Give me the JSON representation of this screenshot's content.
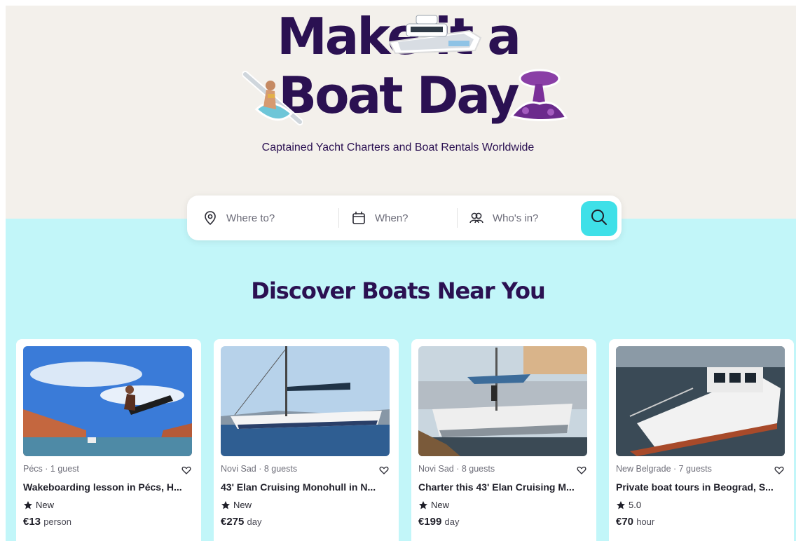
{
  "hero": {
    "headline_line1": "Make    it a",
    "headline_line2": "Boat Day",
    "subtitle": "Captained Yacht Charters and Boat Rentals Worldwide"
  },
  "search": {
    "where_placeholder": "Where to?",
    "when_placeholder": "When?",
    "who_placeholder": "Who's in?",
    "icons": [
      "location-pin-icon",
      "calendar-icon",
      "guests-icon",
      "search-icon"
    ]
  },
  "section": {
    "title": "Discover Boats Near You"
  },
  "listings": [
    {
      "meta": "Pécs · 1 guest",
      "title": "Wakeboarding lesson in Pécs, H...",
      "rating": "New",
      "price": "€13",
      "unit": "person"
    },
    {
      "meta": "Novi Sad · 8 guests",
      "title": "43' Elan Cruising Monohull in N...",
      "rating": "New",
      "price": "€275",
      "unit": "day"
    },
    {
      "meta": "Novi Sad · 8 guests",
      "title": "Charter this 43' Elan Cruising M...",
      "rating": "New",
      "price": "€199",
      "unit": "day"
    },
    {
      "meta": "New Belgrade · 7 guests",
      "title": "Private boat tours in Beograd, S...",
      "rating": "5.0",
      "price": "€70",
      "unit": "hour"
    }
  ],
  "colors": {
    "brand_purple": "#2b1152",
    "hero_bg": "#f3f0eb",
    "lower_bg": "#c2f6f9",
    "search_button": "#3fe0e8"
  }
}
